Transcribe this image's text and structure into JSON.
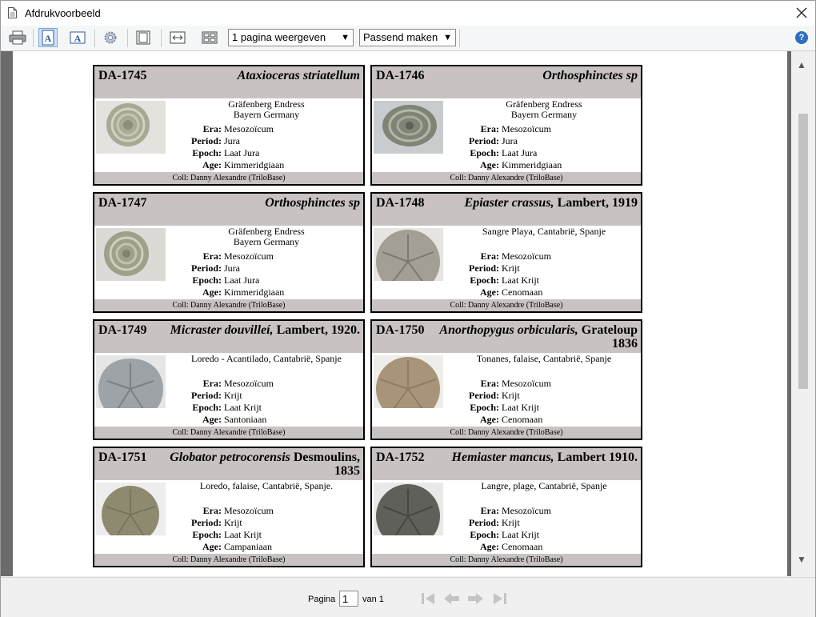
{
  "window": {
    "title": "Afdrukvoorbeeld"
  },
  "toolbar": {
    "pages_select": "1 pagina weergeven",
    "zoom_select": "Passend maken"
  },
  "status": {
    "page_label": "Pagina",
    "page_value": "1",
    "of_label": "van 1"
  },
  "cards": [
    {
      "id": "DA-1745",
      "species_italic": "Ataxioceras striatellum",
      "species_rest": "",
      "loc1": "Gräfenberg Endress",
      "loc2": "Bayern Germany",
      "labels": {
        "era": "Era:",
        "period": "Period:",
        "epoch": "Epoch:",
        "age": "Age:"
      },
      "era": "Mesozoïcum",
      "period": "Jura",
      "epoch": "Laat Jura",
      "age": "Kimmeridgiaan",
      "coll": "Coll: Danny Alexandre (TriloBase)"
    },
    {
      "id": "DA-1746",
      "species_italic": "Orthosphinctes sp",
      "species_rest": "",
      "loc1": "Gräfenberg Endress",
      "loc2": "Bayern Germany",
      "labels": {
        "era": "Era:",
        "period": "Period:",
        "epoch": "Epoch:",
        "age": "Age:"
      },
      "era": "Mesozoïcum",
      "period": "Jura",
      "epoch": "Laat Jura",
      "age": "Kimmeridgiaan",
      "coll": "Coll: Danny Alexandre (TriloBase)"
    },
    {
      "id": "DA-1747",
      "species_italic": "Orthosphinctes sp",
      "species_rest": "",
      "loc1": "Gräfenberg Endress",
      "loc2": "Bayern Germany",
      "labels": {
        "era": "Era:",
        "period": "Period:",
        "epoch": "Epoch:",
        "age": "Age:"
      },
      "era": "Mesozoïcum",
      "period": "Jura",
      "epoch": "Laat Jura",
      "age": "Kimmeridgiaan",
      "coll": "Coll: Danny Alexandre (TriloBase)"
    },
    {
      "id": "DA-1748",
      "species_italic": "Epiaster crassus,",
      "species_rest": " Lambert, 1919",
      "loc1": "Sangre Playa, Cantabrië, Spanje",
      "loc2": "",
      "labels": {
        "era": "Era:",
        "period": "Period:",
        "epoch": "Epoch:",
        "age": "Age:"
      },
      "era": "Mesozoïcum",
      "period": "Krijt",
      "epoch": "Laat Krijt",
      "age": "Cenomaan",
      "coll": "Coll: Danny Alexandre (TriloBase)"
    },
    {
      "id": "DA-1749",
      "species_italic": "Micraster douvilleí,",
      "species_rest": " Lambert, 1920.",
      "loc1": "Loredo - Acantilado, Cantabrië, Spanje",
      "loc2": "",
      "labels": {
        "era": "Era:",
        "period": "Period:",
        "epoch": "Epoch:",
        "age": "Age:"
      },
      "era": "Mesozoïcum",
      "period": "Krijt",
      "epoch": "Laat Krijt",
      "age": "Santoniaan",
      "coll": "Coll: Danny Alexandre (TriloBase)"
    },
    {
      "id": "DA-1750",
      "species_italic": "Anorthopygus orbicularis,",
      "species_rest": " Grateloup 1836",
      "loc1": "Tonanes, falaise, Cantabrië, Spanje",
      "loc2": "",
      "labels": {
        "era": "Era:",
        "period": "Period:",
        "epoch": "Epoch:",
        "age": "Age:"
      },
      "era": "Mesozoïcum",
      "period": "Krijt",
      "epoch": "Laat Krijt",
      "age": "Cenomaan",
      "coll": "Coll: Danny Alexandre (TriloBase)"
    },
    {
      "id": "DA-1751",
      "species_italic": "Globator petrocorensis",
      "species_rest": " Desmoulins, 1835",
      "loc1": "Loredo, falaise, Cantabrië, Spanje.",
      "loc2": "",
      "labels": {
        "era": "Era:",
        "period": "Period:",
        "epoch": "Epoch:",
        "age": "Age:"
      },
      "era": "Mesozoïcum",
      "period": "Krijt",
      "epoch": "Laat Krijt",
      "age": "Campaniaan",
      "coll": "Coll: Danny Alexandre (TriloBase)"
    },
    {
      "id": "DA-1752",
      "species_italic": "Hemiaster mancus,",
      "species_rest": " Lambert 1910.",
      "loc1": "Langre, plage, Cantabrië, Spanje",
      "loc2": "",
      "labels": {
        "era": "Era:",
        "period": "Period:",
        "epoch": "Epoch:",
        "age": "Age:"
      },
      "era": "Mesozoïcum",
      "period": "Krijt",
      "epoch": "Laat Krijt",
      "age": "Cenomaan",
      "coll": "Coll: Danny Alexandre (TriloBase)"
    }
  ]
}
